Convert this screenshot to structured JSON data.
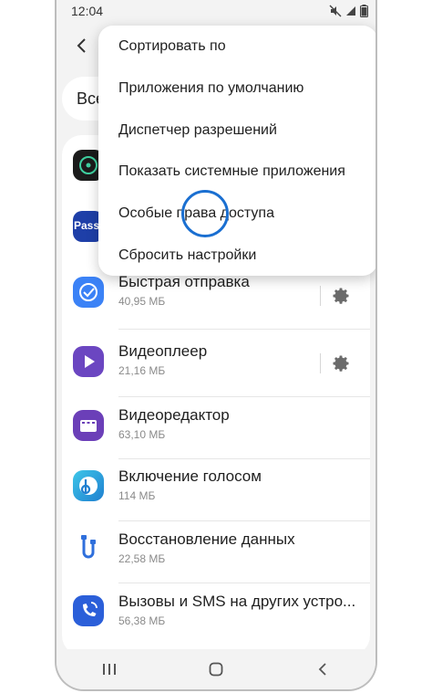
{
  "status_bar": {
    "time": "12:04"
  },
  "search": {
    "partial_text": "Все"
  },
  "menu": {
    "items": [
      {
        "label": "Сортировать по"
      },
      {
        "label": "Приложения по умолчанию"
      },
      {
        "label": "Диспетчер разрешений"
      },
      {
        "label": "Показать системные приложения"
      },
      {
        "label": "Особые права доступа"
      },
      {
        "label": "Сбросить настройки"
      }
    ]
  },
  "apps": [
    {
      "name": "Быстрая отправка",
      "size": "40,95 МБ",
      "icon": "quick-share-icon",
      "color": "#3b82f6"
    },
    {
      "name": "Видеоплеер",
      "size": "21,16 МБ",
      "icon": "video-player-icon",
      "color": "#6b46c1"
    },
    {
      "name": "Видеоредактор",
      "size": "63,10 МБ",
      "icon": "video-editor-icon",
      "color": "#6b3fb8"
    },
    {
      "name": "Включение голосом",
      "size": "114 МБ",
      "icon": "voice-wakeup-icon",
      "color": "#2aa0d8"
    },
    {
      "name": "Восстановление данных",
      "size": "22,58 МБ",
      "icon": "data-restore-icon",
      "color": "#2f6fdc"
    },
    {
      "name": "Вызовы и SMS на других устро...",
      "size": "56,38 МБ",
      "icon": "calls-sms-icon",
      "color": "#2b5fd9"
    }
  ],
  "partial_apps": [
    {
      "icon": "system-app-icon",
      "color": "#1b1b1b"
    },
    {
      "icon": "samsung-pass-icon",
      "label": "Pass",
      "color": "#1e3fa8"
    }
  ],
  "colors": {
    "accent": "#1a6fd1",
    "background": "#f3f3f3"
  }
}
